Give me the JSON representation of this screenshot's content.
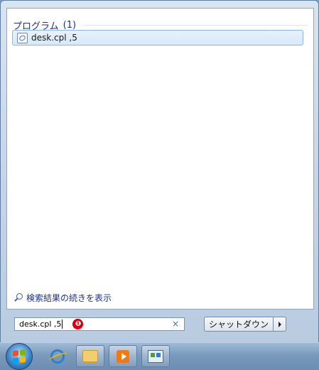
{
  "results": {
    "group_title": "プログラム",
    "group_count": "(1)",
    "items": [
      {
        "label": "desk.cpl ,5",
        "icon": "control-panel-file-icon"
      }
    ]
  },
  "see_more": {
    "label": "検索結果の続きを表示",
    "icon": "search-icon"
  },
  "search": {
    "value": "desk.cpl ,5",
    "clear_label": "×"
  },
  "annotation": {
    "marker": "❶",
    "marker_color": "#d10010"
  },
  "shutdown": {
    "label": "シャットダウン",
    "arrow_icon": "triangle-right-icon"
  },
  "taskbar": {
    "items": [
      {
        "name": "start-orb",
        "icon": "windows-flag-icon"
      },
      {
        "name": "internet-explorer",
        "icon": "ie-icon"
      },
      {
        "name": "explorer",
        "icon": "folder-icon"
      },
      {
        "name": "media-player",
        "icon": "media-player-icon"
      },
      {
        "name": "control-panel",
        "icon": "control-panel-icon"
      }
    ]
  },
  "colors": {
    "heading": "#1e3287",
    "selection_border": "#8fb7de",
    "taskbar": "#7a9abc"
  }
}
